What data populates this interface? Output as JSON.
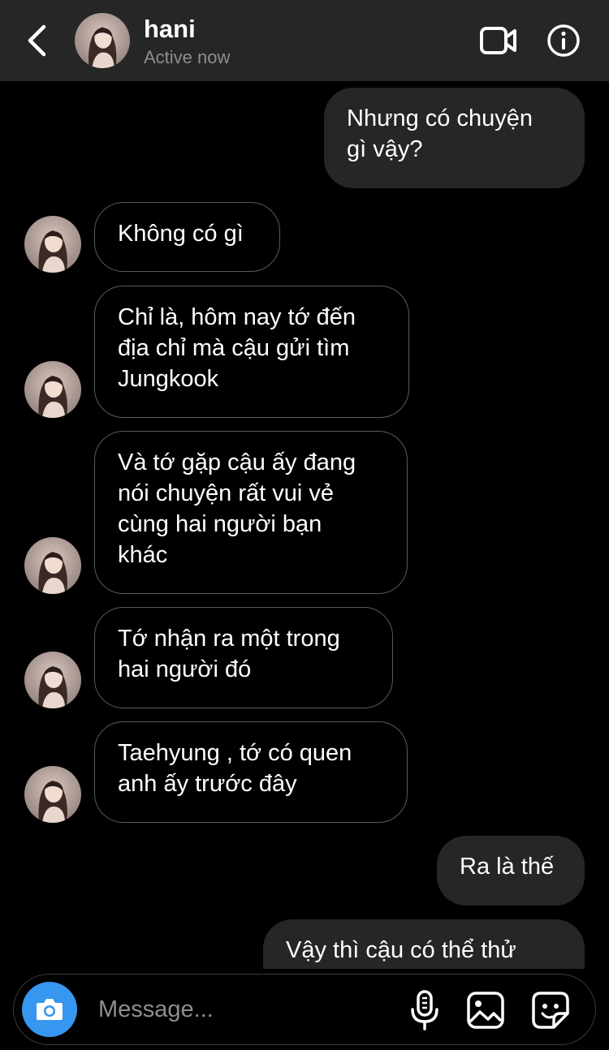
{
  "header": {
    "name": "hani",
    "status": "Active now"
  },
  "messages": [
    {
      "direction": "outgoing",
      "text": "Nhưng có chuyện\ngì vậy?"
    },
    {
      "direction": "incoming",
      "text": "Không có gì"
    },
    {
      "direction": "incoming",
      "text": "Chỉ là, hôm nay tớ đến\nđịa chỉ mà cậu gửi tìm\nJungkook"
    },
    {
      "direction": "incoming",
      "text": "Và tớ gặp cậu ấy đang\nnói chuyện rất vui vẻ\ncùng hai người bạn\nkhác"
    },
    {
      "direction": "incoming",
      "text": "Tớ nhận ra một trong\nhai người đó"
    },
    {
      "direction": "incoming",
      "text": "Taehyung , tớ có quen\nanh ấy trước đây"
    },
    {
      "direction": "outgoing",
      "text": "Ra là thế"
    },
    {
      "direction": "outgoing",
      "text": "Vậy thì cậu có thể thử"
    }
  ],
  "composer": {
    "placeholder": "Message..."
  },
  "icons": {
    "back": "chevron-left-icon",
    "video": "video-camera-icon",
    "info": "info-icon",
    "camera": "camera-icon",
    "mic": "microphone-icon",
    "gallery": "image-icon",
    "sticker": "sticker-icon"
  },
  "colors": {
    "background": "#000000",
    "header": "#262626",
    "outgoing_bubble": "#262626",
    "incoming_border": "#5a5a5a",
    "accent": "#3797f0",
    "secondary_text": "#8e8e8e"
  }
}
